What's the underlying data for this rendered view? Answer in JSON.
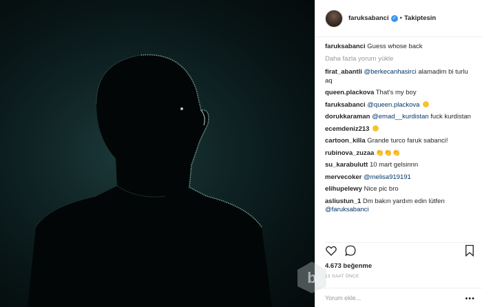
{
  "header": {
    "username": "faruksabanci",
    "follow_status": "Takiptesin",
    "verified_glyph": "✓"
  },
  "comments": {
    "caption": {
      "user": "faruksabanci",
      "text": "Guess whose back"
    },
    "load_more": "Daha fazla yorum yükle",
    "items": [
      {
        "user": "firat_abantli",
        "mention": "@berkecanhasirci",
        "text": " alamadim bi turlu aq"
      },
      {
        "user": "queen.plackova",
        "mention": "",
        "text": "That's my boy"
      },
      {
        "user": "faruksabanci",
        "mention": "@queen.plackova",
        "text": ""
      },
      {
        "user": "dorukkaraman",
        "mention": "@emad__kurdistan",
        "text": " fuck kurdistan"
      },
      {
        "user": "ecemdeniz213",
        "mention": "",
        "text": ""
      },
      {
        "user": "cartoon_killa",
        "mention": "",
        "text": "Grande turco faruk sabanci!"
      },
      {
        "user": "rubinova_zuzaa",
        "mention": "",
        "text": "👏👏👏"
      },
      {
        "user": "su_karabulutt",
        "mention": "",
        "text": "10 mart gelsinnn"
      },
      {
        "user": "mervecoker",
        "mention": "@melisa919191",
        "text": ""
      },
      {
        "user": "elihupelewy",
        "mention": "",
        "text": "Nice pic bro"
      },
      {
        "user": "asliustun_1",
        "mention": "",
        "text": "Dm bakın yardım edin lütfen"
      }
    ],
    "last_mention": "@faruksabanci"
  },
  "stats": {
    "likes": "4.673 beğenme",
    "time": "13 SAAT ÖNCE"
  },
  "composer": {
    "placeholder": "Yorum ekle...",
    "more_glyph": "•••"
  },
  "icons": {
    "like": "heart-icon",
    "comment": "comment-bubble-icon",
    "save": "bookmark-icon",
    "more": "more-options-icon"
  }
}
